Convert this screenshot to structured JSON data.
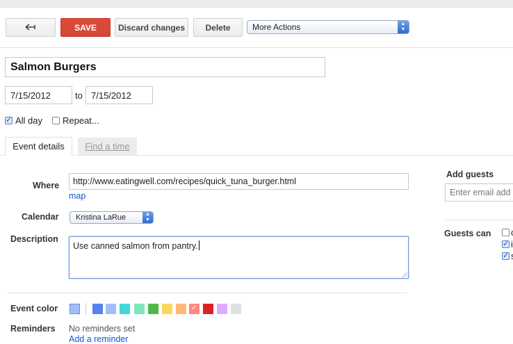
{
  "toolbar": {
    "back_icon": "arrow-left-icon",
    "save_label": "SAVE",
    "discard_label": "Discard changes",
    "delete_label": "Delete",
    "more_actions": "More Actions",
    "save_color": "#d14836"
  },
  "event": {
    "title": "Salmon Burgers",
    "start_date": "7/15/2012",
    "to_label": "to",
    "end_date": "7/15/2012",
    "all_day_label": "All day",
    "all_day_checked": true,
    "repeat_label": "Repeat...",
    "repeat_checked": false
  },
  "tabs": {
    "event_details": "Event details",
    "find_a_time": "Find a time"
  },
  "details": {
    "where_label": "Where",
    "where_value": "http://www.eatingwell.com/recipes/quick_tuna_burger.html",
    "map_link": "map",
    "calendar_label": "Calendar",
    "calendar_value": "Kristina LaRue",
    "description_label": "Description",
    "description_value": "Use canned salmon from pantry.",
    "event_color_label": "Event color",
    "colors": [
      "#a4bdfc",
      "#5484ed",
      "#a4bdfc",
      "#46d6db",
      "#7ae7bf",
      "#51b749",
      "#fbd75b",
      "#ffb878",
      "#ff887c",
      "#dc2127",
      "#dbadff",
      "#e1e1e1"
    ],
    "selected_color_index": 8,
    "reminders_label": "Reminders",
    "reminders_value": "No reminders set",
    "add_reminder_link": "Add a reminder"
  },
  "guests": {
    "add_guests_label": "Add guests",
    "email_placeholder": "Enter email add",
    "guests_can_label": "Guests can",
    "options_checked": [
      false,
      true,
      true
    ],
    "option_fragments": [
      "c",
      "i",
      "s"
    ]
  }
}
